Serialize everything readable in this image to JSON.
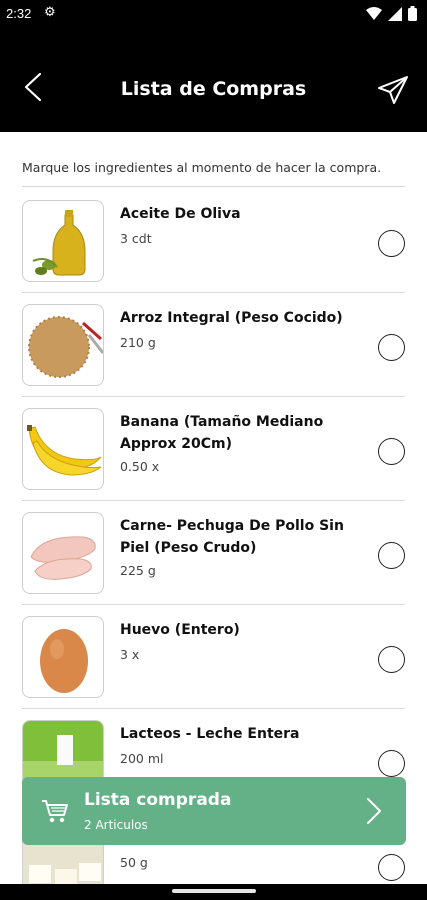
{
  "status_bar": {
    "time": "2:32"
  },
  "header": {
    "title": "Lista de Compras"
  },
  "instructions": "Marque los ingredientes al momento de hacer la compra.",
  "items": [
    {
      "name": "Aceite De Oliva",
      "quantity": "3 cdt",
      "icon": "olive-oil-icon"
    },
    {
      "name": "Arroz Integral (Peso Cocido)",
      "quantity": "210 g",
      "icon": "rice-icon"
    },
    {
      "name": "Banana (Tamaño Mediano Approx 20Cm)",
      "quantity": "0.50 x",
      "icon": "banana-icon"
    },
    {
      "name": "Carne- Pechuga De Pollo Sin Piel (Peso Crudo)",
      "quantity": "225 g",
      "icon": "chicken-breast-icon"
    },
    {
      "name": "Huevo (Entero)",
      "quantity": "3 x",
      "icon": "egg-icon"
    },
    {
      "name": "Lacteos - Leche Entera",
      "quantity": "200 ml",
      "icon": "milk-icon"
    },
    {
      "name": "",
      "quantity": "50 g",
      "icon": "cheese-icon"
    }
  ],
  "done_bar": {
    "title": "Lista comprada",
    "subtitle": "2 Articulos"
  },
  "colors": {
    "header_bg": "#000000",
    "accent_green": "#65b187",
    "page_bg": "#ffffff"
  }
}
